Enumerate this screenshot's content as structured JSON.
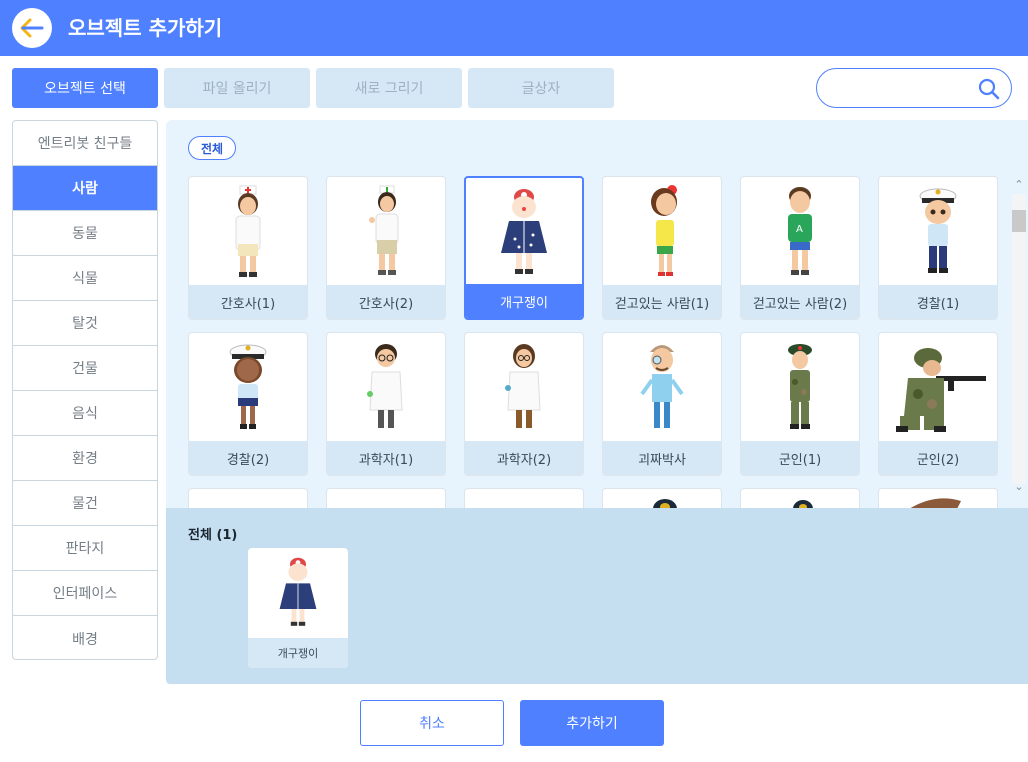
{
  "header": {
    "title": "오브젝트 추가하기"
  },
  "tabs": [
    {
      "label": "오브젝트 선택",
      "active": true
    },
    {
      "label": "파일 올리기",
      "active": false
    },
    {
      "label": "새로 그리기",
      "active": false
    },
    {
      "label": "글상자",
      "active": false
    }
  ],
  "search": {
    "value": "",
    "placeholder": ""
  },
  "sidebar": {
    "items": [
      {
        "label": "엔트리봇 친구들",
        "active": false
      },
      {
        "label": "사람",
        "active": true
      },
      {
        "label": "동물",
        "active": false
      },
      {
        "label": "식물",
        "active": false
      },
      {
        "label": "탈것",
        "active": false
      },
      {
        "label": "건물",
        "active": false
      },
      {
        "label": "음식",
        "active": false
      },
      {
        "label": "환경",
        "active": false
      },
      {
        "label": "물건",
        "active": false
      },
      {
        "label": "판타지",
        "active": false
      },
      {
        "label": "인터페이스",
        "active": false
      },
      {
        "label": "배경",
        "active": false
      }
    ]
  },
  "filter": {
    "label": "전체"
  },
  "objects": [
    {
      "label": "간호사(1)",
      "icon": "nurse-1-icon",
      "selected": false
    },
    {
      "label": "간호사(2)",
      "icon": "nurse-2-icon",
      "selected": false
    },
    {
      "label": "개구쟁이",
      "icon": "mischief-kid-icon",
      "selected": true
    },
    {
      "label": "걷고있는 사람(1)",
      "icon": "walking-person-1-icon",
      "selected": false
    },
    {
      "label": "걷고있는 사람(2)",
      "icon": "walking-person-2-icon",
      "selected": false
    },
    {
      "label": "경찰(1)",
      "icon": "police-1-icon",
      "selected": false
    },
    {
      "label": "경찰(2)",
      "icon": "police-2-icon",
      "selected": false
    },
    {
      "label": "과학자(1)",
      "icon": "scientist-1-icon",
      "selected": false
    },
    {
      "label": "과학자(2)",
      "icon": "scientist-2-icon",
      "selected": false
    },
    {
      "label": "괴짜박사",
      "icon": "quirky-doctor-icon",
      "selected": false
    },
    {
      "label": "군인(1)",
      "icon": "soldier-1-icon",
      "selected": false
    },
    {
      "label": "군인(2)",
      "icon": "soldier-2-icon",
      "selected": false
    }
  ],
  "selected_panel": {
    "title": "전체 (1)",
    "items": [
      {
        "label": "개구쟁이",
        "icon": "mischief-kid-icon"
      }
    ]
  },
  "buttons": {
    "cancel": "취소",
    "add": "추가하기"
  },
  "colors": {
    "accent": "#4f80ff",
    "tab_inactive": "#d6e8f5",
    "panel_bg": "#e8f4fd",
    "selected_panel_bg": "#c5dff1"
  }
}
